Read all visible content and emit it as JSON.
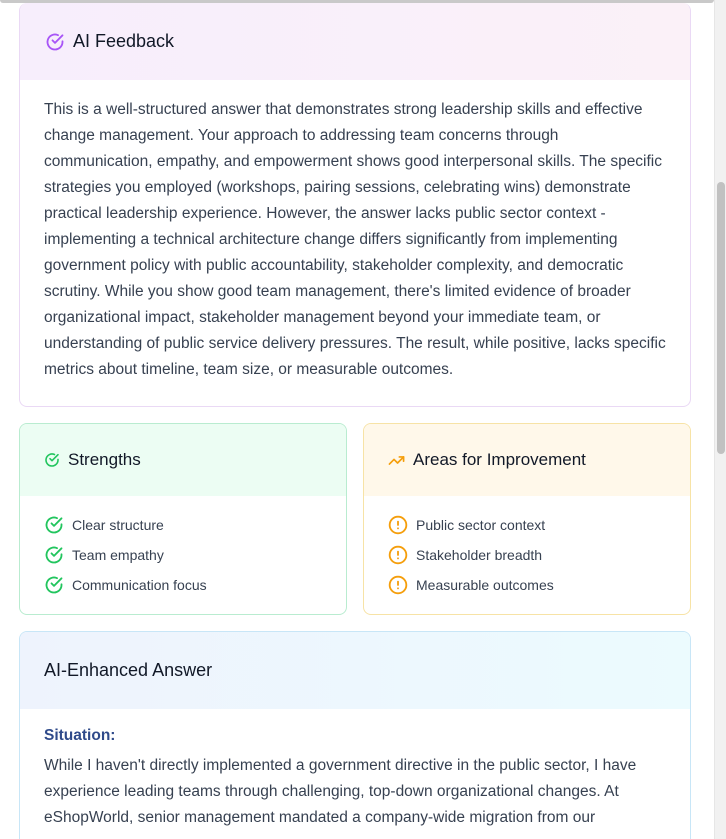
{
  "feedback": {
    "title": "AI Feedback",
    "icon": "check-circle-icon",
    "accent": "#a855f7",
    "body": "This is a well-structured answer that demonstrates strong leadership skills and effective change management. Your approach to addressing team concerns through communication, empathy, and empowerment shows good interpersonal skills. The specific strategies you employed (workshops, pairing sessions, celebrating wins) demonstrate practical leadership experience. However, the answer lacks public sector context - implementing a technical architecture change differs significantly from implementing government policy with public accountability, stakeholder complexity, and democratic scrutiny. While you show good team management, there's limited evidence of broader organizational impact, stakeholder management beyond your immediate team, or understanding of public service delivery pressures. The result, while positive, lacks specific metrics about timeline, team size, or measurable outcomes."
  },
  "strengths": {
    "title": "Strengths",
    "icon": "check-circle-icon",
    "accent": "#22c55e",
    "items": [
      {
        "label": "Clear structure"
      },
      {
        "label": "Team empathy"
      },
      {
        "label": "Communication focus"
      }
    ]
  },
  "improvements": {
    "title": "Areas for Improvement",
    "icon": "trending-up-icon",
    "accent": "#f59e0b",
    "items": [
      {
        "label": "Public sector context"
      },
      {
        "label": "Stakeholder breadth"
      },
      {
        "label": "Measurable outcomes"
      }
    ]
  },
  "enhanced": {
    "title": "AI-Enhanced Answer",
    "situation_label": "Situation:",
    "situation_text": "While I haven't directly implemented a government directive in the public sector, I have experience leading teams through challenging, top-down organizational changes. At eShopWorld, senior management mandated a company-wide migration from our"
  }
}
